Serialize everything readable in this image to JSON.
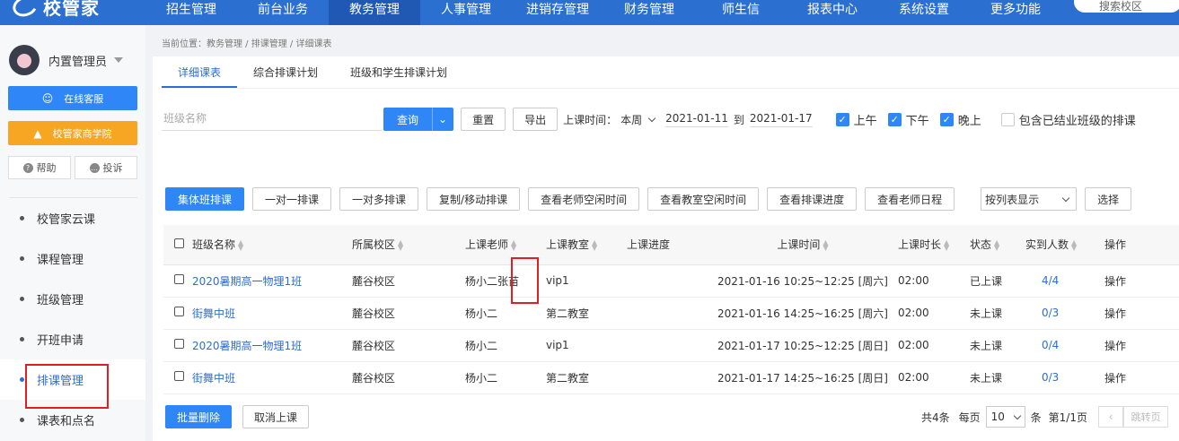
{
  "app": {
    "logo_text": "校管家",
    "search_placeholder": "搜索校区"
  },
  "topnav": [
    "招生管理",
    "前台业务",
    "教务管理",
    "人事管理",
    "进销存管理",
    "财务管理",
    "师生信",
    "报表中心",
    "系统设置",
    "更多功能"
  ],
  "user": {
    "name": "内置管理员"
  },
  "sidebar": {
    "service_button": "在线客服",
    "academy_button": "校管家商学院",
    "help": "帮助",
    "complain": "投诉",
    "menu": [
      "校管家云课",
      "课程管理",
      "班级管理",
      "开班申请",
      "排课管理",
      "课表和点名"
    ]
  },
  "breadcrumb": "当前位置：教务管理 / 排课管理 / 详细课表",
  "tabs": [
    "详细课表",
    "综合排课计划",
    "班级和学生排课计划"
  ],
  "filters": {
    "class_placeholder": "班级名称",
    "search": "查询",
    "reset": "重置",
    "export": "导出",
    "time_label": "上课时间：",
    "period": "本周",
    "date_from": "2021-01-11",
    "to": "到",
    "date_to": "2021-01-17",
    "morning": "上午",
    "afternoon": "下午",
    "evening": "晚上",
    "include_ended": "包含已结业班级的排课"
  },
  "actions": [
    "集体班排课",
    "一对一排课",
    "一对多排课",
    "复制/移动排课",
    "查看老师空闲时间",
    "查看教室空闲时间",
    "查看排课进度",
    "查看老师日程"
  ],
  "view_select": "按列表显示",
  "more_button": "选择",
  "table": {
    "headers": [
      "班级名称",
      "所属校区",
      "上课老师",
      "上课教室",
      "上课进度",
      "上课时间",
      "上课时长",
      "状态",
      "实到人数",
      "操作"
    ],
    "rows": [
      {
        "class": "2020暑期高一物理1班",
        "campus": "麓谷校区",
        "teacher": "杨小二",
        "teacher2": "张苗",
        "room": "vip1",
        "progress": "",
        "time": "2021-01-16 10:25~12:25 [周六]",
        "duration": "02:00",
        "status": "已上课",
        "attend": "4/4",
        "op": "操作"
      },
      {
        "class": "街舞中班",
        "campus": "麓谷校区",
        "teacher": "杨小二",
        "teacher2": "",
        "room": "第二教室",
        "progress": "",
        "time": "2021-01-16 14:25~16:25 [周六]",
        "duration": "02:00",
        "status": "未上课",
        "attend": "0/3",
        "op": "操作"
      },
      {
        "class": "2020暑期高一物理1班",
        "campus": "麓谷校区",
        "teacher": "杨小二",
        "teacher2": "",
        "room": "vip1",
        "progress": "",
        "time": "2021-01-17 10:25~12:25 [周日]",
        "duration": "02:00",
        "status": "未上课",
        "attend": "0/4",
        "op": "操作"
      },
      {
        "class": "街舞中班",
        "campus": "麓谷校区",
        "teacher": "杨小二",
        "teacher2": "",
        "room": "第二教室",
        "progress": "",
        "time": "2021-01-17 14:25~16:25 [周日]",
        "duration": "02:00",
        "status": "未上课",
        "attend": "0/3",
        "op": "操作"
      }
    ]
  },
  "footer": {
    "batch_delete": "批量删除",
    "cancel": "取消上课",
    "total": "共4条",
    "per_page_label": "每页",
    "per_page": "10",
    "unit": "条",
    "page_info": "第1/1页",
    "jump": "跳转页"
  },
  "colors": {
    "brand": "#2b6fd1",
    "primary": "#2f86f6",
    "orange": "#f6a623",
    "danger": "#e84c3d",
    "annotation": "#e02020"
  }
}
